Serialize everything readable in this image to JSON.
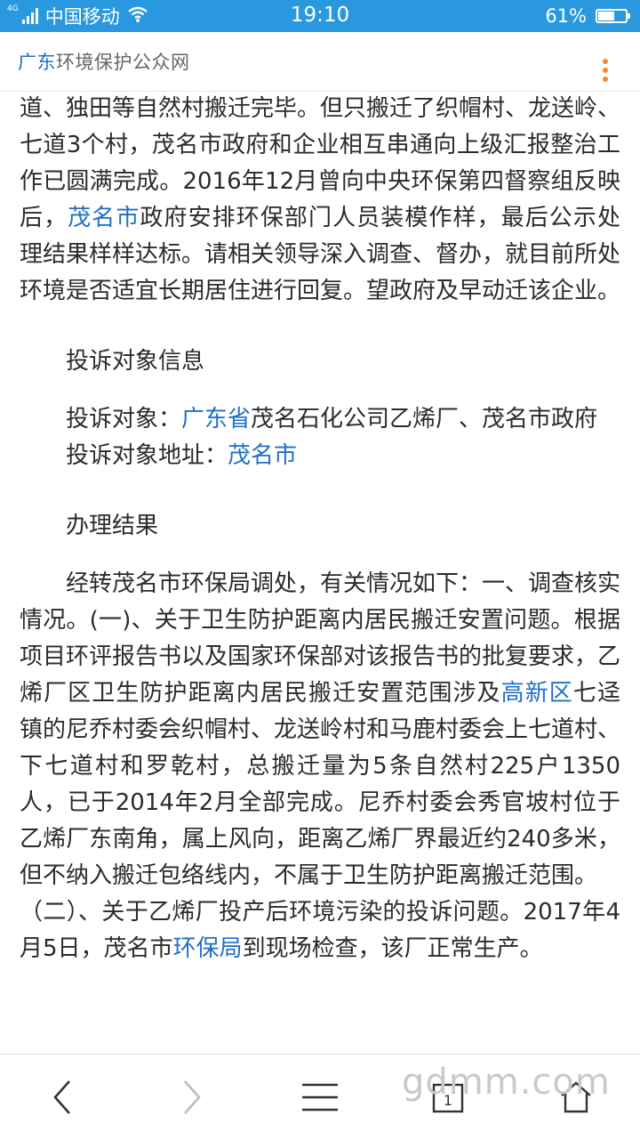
{
  "status_bar": {
    "network_type": "4G",
    "carrier": "中国移动",
    "time": "19:10",
    "battery_percent": "61%",
    "battery_level": 0.61
  },
  "header": {
    "site_name_highlight": "广东",
    "site_name_rest": "环境保护公众网"
  },
  "article": {
    "p1_a": "道、独田等自然村搬迁完毕。但只搬迁了织帽村、龙送岭、七道3个村，茂名市政府和企业相互串通向上级汇报整治工作已圆满完成。2016年12月曾向中央环保第四督察组反映后，",
    "p1_link": "茂名市",
    "p1_b": "政府安排环保部门人员装模作样，最后公示处理结果样样达标。请相关领导深入调查、督办，就目前所处环境是否适宜长期居住进行回复。望政府及早动迁该企业。",
    "section_target_info": "投诉对象信息",
    "target_label": "投诉对象：",
    "target_link": "广东省",
    "target_value": "茂名石化公司乙烯厂、茂名市政府",
    "address_label": "投诉对象地址：",
    "address_link": "茂名市",
    "section_result": "办理结果",
    "result_a": "经转茂名市环保局调处，有关情况如下：一、调查核实情况。(一)、关于卫生防护距离内居民搬迁安置问题。根据项目环评报告书以及国家环保部对该报告书的批复要求，乙烯厂区卫生防护距离内居民搬迁安置范围涉及",
    "result_link": "高新区",
    "result_b": "七迳镇的尼乔村委会织帽村、龙送岭村和马鹿村委会上七道村、下七道村和罗乾村，总搬迁量为5条自然村225户1350人，已于2014年2月全部完成。尼乔村委会秀官坡村位于乙烯厂东南角，属上风向，距离乙烯厂界最近约240多米，但不纳入搬迁包络线内，不属于卫生防护距离搬迁范围。",
    "result2_a": "（二）、关于乙烯厂投产后环境污染的投诉问题。2017年4月5日，茂名市",
    "result2_link": "环保局",
    "result2_b": "到现场检查，该厂正常生产。"
  },
  "bottom_bar": {
    "back_icon": "chevron-left-icon",
    "forward_icon": "chevron-right-icon",
    "menu_icon": "hamburger-menu-icon",
    "tabs_icon": "tabs-icon",
    "home_icon": "home-icon",
    "tab_count": "1",
    "watermark": "gdmm.com"
  },
  "colors": {
    "status_bar": "#2a98de",
    "link": "#1f6fc7",
    "more_dots": "#f08a2d"
  }
}
